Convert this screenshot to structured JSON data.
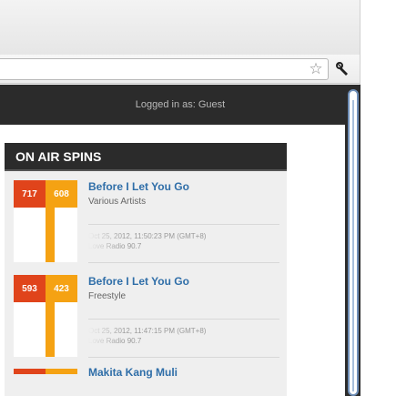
{
  "browser": {
    "bookmark_icon": "star-icon",
    "settings_icon": "wrench-icon"
  },
  "page": {
    "login_text": "Logged in as: Guest",
    "section_title": "ON AIR SPINS"
  },
  "spins": [
    {
      "art_left": "717",
      "art_right": "608",
      "title": "Before I Let You Go",
      "artist": "Various Artists",
      "time": "Oct 25, 2012, 11:50:23 PM (GMT+8)",
      "station": "Love Radio 90.7"
    },
    {
      "art_left": "593",
      "art_right": "423",
      "title": "Before I Let You Go",
      "artist": "Freestyle",
      "time": "Oct 25, 2012, 11:47:15 PM (GMT+8)",
      "station": "Love Radio 90.7"
    },
    {
      "title": "Makita Kang Muli"
    }
  ],
  "colors": {
    "art_red": "#e0441b",
    "art_orange": "#f5a213",
    "title_blue": "#2f6ea8",
    "header_dark": "#2b2b2b"
  }
}
